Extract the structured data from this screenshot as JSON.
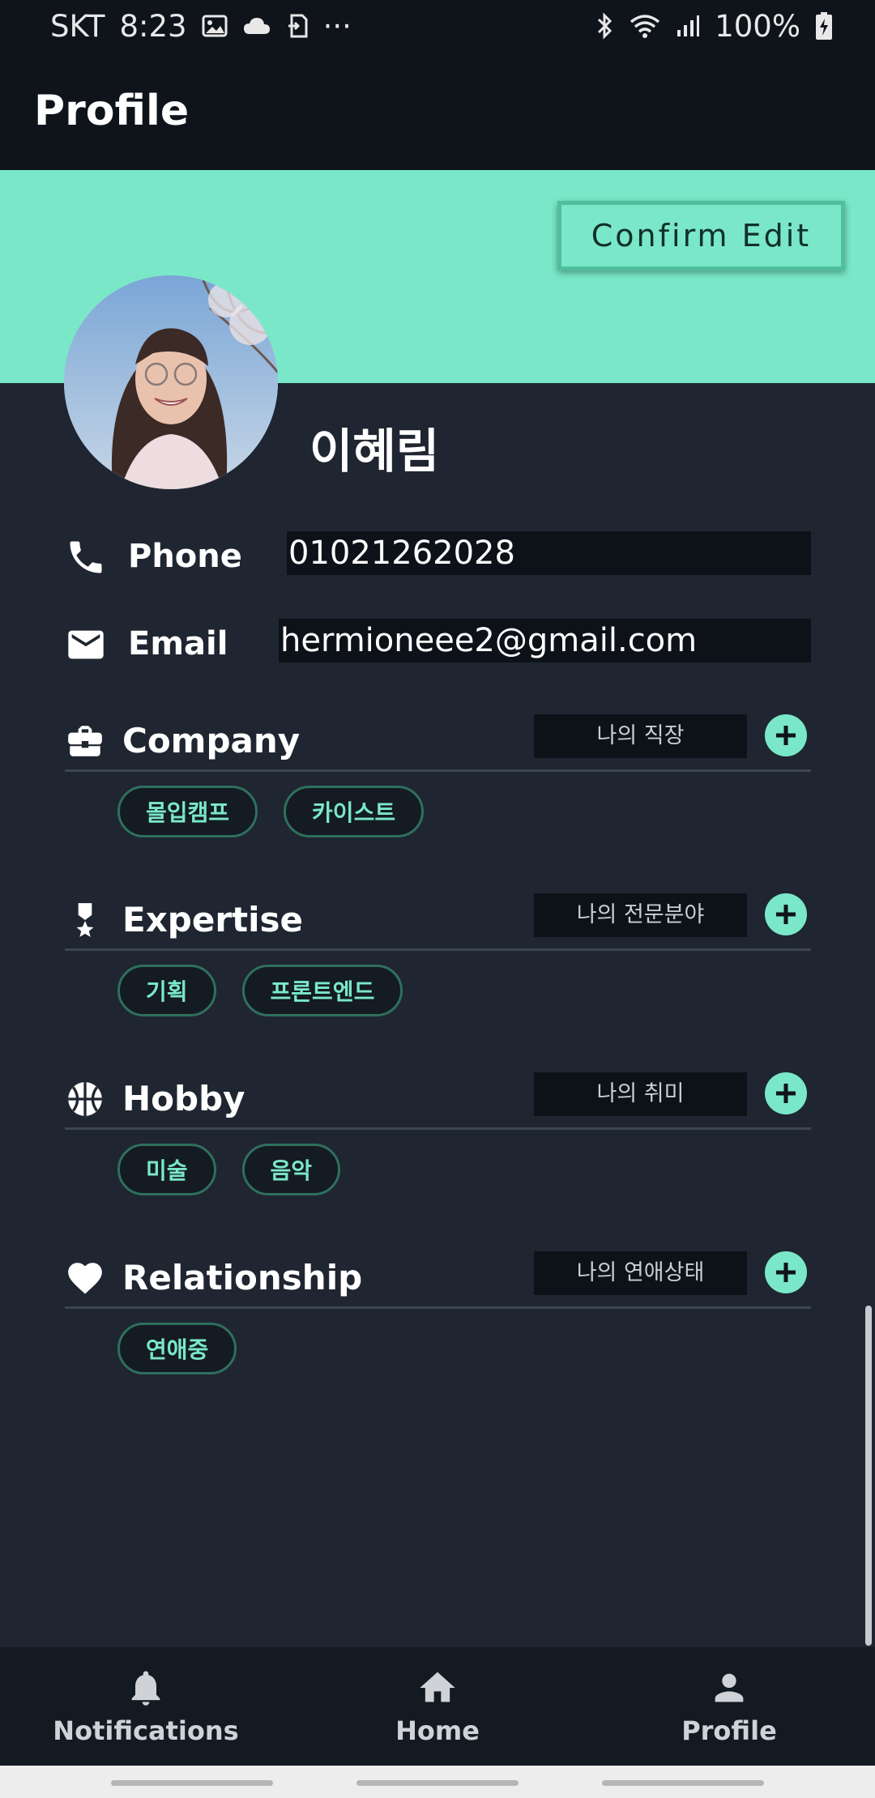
{
  "status_bar": {
    "carrier": "SKT",
    "time": "8:23",
    "overflow": "···",
    "battery": "100%"
  },
  "app_bar": {
    "title": "Profile"
  },
  "header": {
    "confirm_label": "Confirm Edit",
    "accent_color": "#7ae8c8"
  },
  "profile": {
    "name": "이혜림",
    "phone_label": "Phone",
    "phone_value": "01021262028",
    "email_label": "Email",
    "email_value": "hermioneee2@gmail.com"
  },
  "sections": [
    {
      "title": "Company",
      "icon": "briefcase-icon",
      "placeholder": "나의 직장",
      "chips": [
        "몰입캠프",
        "카이스트"
      ]
    },
    {
      "title": "Expertise",
      "icon": "medal-icon",
      "placeholder": "나의 전문분야",
      "chips": [
        "기획",
        "프론트엔드"
      ]
    },
    {
      "title": "Hobby",
      "icon": "basketball-icon",
      "placeholder": "나의 취미",
      "chips": [
        "미술",
        "음악"
      ]
    },
    {
      "title": "Relationship",
      "icon": "heart-icon",
      "placeholder": "나의 연애상태",
      "chips": [
        "연애중"
      ]
    }
  ],
  "bottom_nav": [
    {
      "label": "Notifications",
      "icon": "bell-icon"
    },
    {
      "label": "Home",
      "icon": "home-icon"
    },
    {
      "label": "Profile",
      "icon": "person-icon"
    }
  ]
}
